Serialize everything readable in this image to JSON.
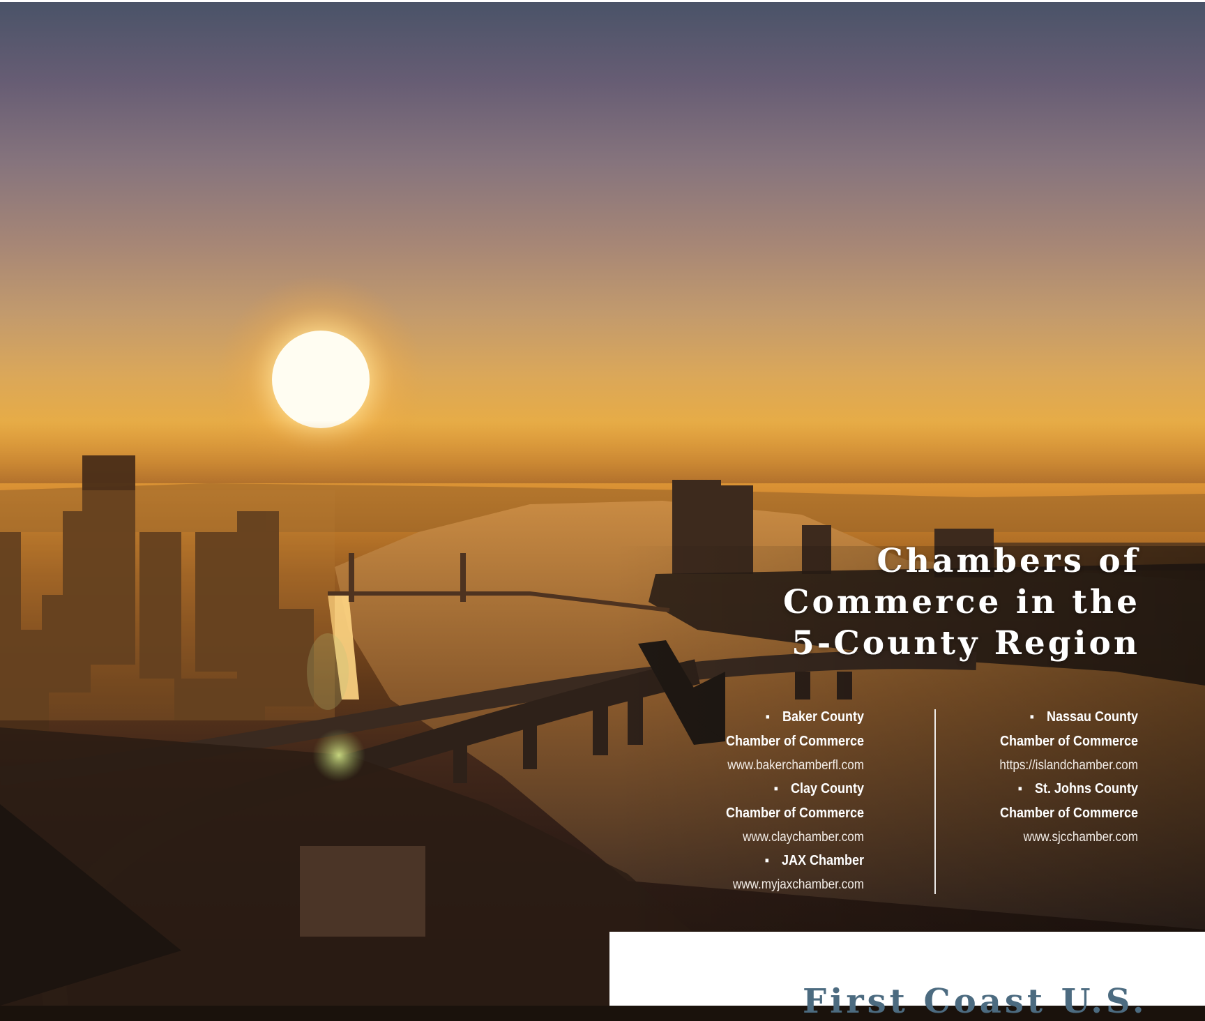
{
  "heading": {
    "line1": "Chambers of",
    "line2": "Commerce in the",
    "line3": "5-County Region"
  },
  "chambers_left": [
    {
      "name_line1": "Baker County",
      "name_line2": "Chamber of Commerce",
      "url": "www.bakerchamberfl.com"
    },
    {
      "name_line1": "Clay County",
      "name_line2": "Chamber of Commerce",
      "url": "www.claychamber.com"
    },
    {
      "name_line1": "JAX Chamber",
      "url": "www.myjaxchamber.com"
    }
  ],
  "chambers_right": [
    {
      "name_line1": "Nassau County",
      "name_line2": "Chamber of Commerce",
      "url": "https://islandchamber.com"
    },
    {
      "name_line1": "St. Johns County",
      "name_line2": "Chamber of Commerce",
      "url": "www.sjcchamber.com"
    }
  ],
  "bullet_glyph": "▪",
  "next_section": {
    "title": "First Coast U.S."
  },
  "colors": {
    "text": "#ffffff",
    "panel": "#ffffff",
    "panel_title": "#4c6b80",
    "sky_top": "#4a5368",
    "sun_glow": "#e7ac46"
  }
}
